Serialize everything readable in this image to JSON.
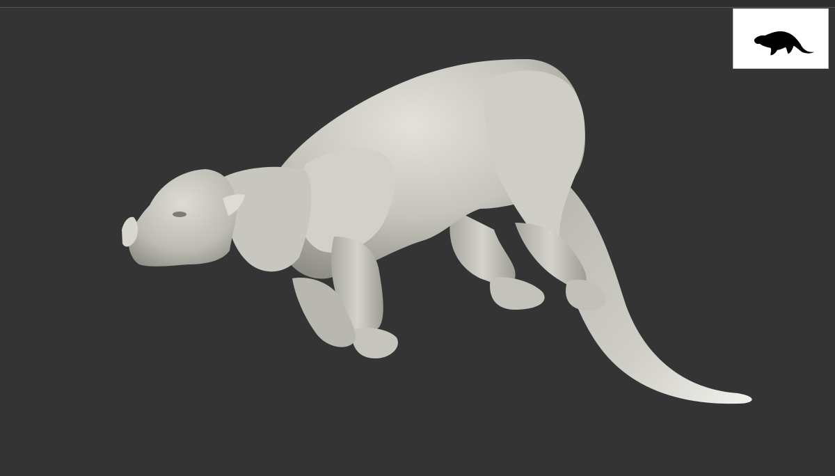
{
  "viewport": {
    "background_color": "#343434",
    "model_color": "#c9c8c0",
    "model_shadow_color": "#8e8d86",
    "model_highlight_color": "#e6e5de"
  },
  "navigator_thumbnail": {
    "icon": "creature-silhouette-icon",
    "background_color": "#ffffff",
    "silhouette_color": "#000000"
  }
}
